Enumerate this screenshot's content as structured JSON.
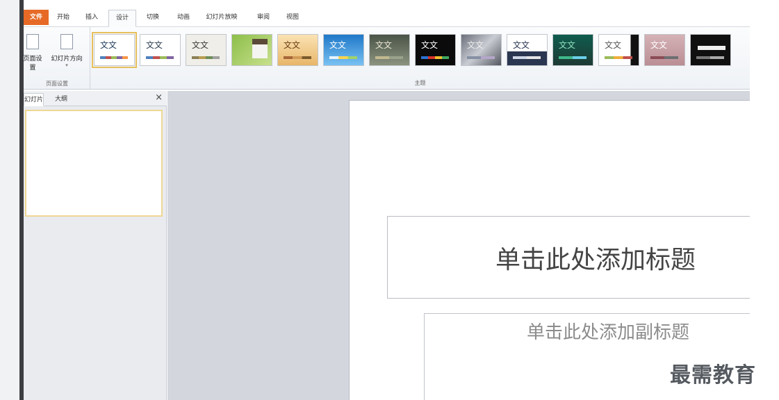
{
  "tabs": {
    "file": "文件",
    "home": "开始",
    "insert": "插入",
    "design": "设计",
    "transitions": "切换",
    "animations": "动画",
    "slideshow": "幻灯片放映",
    "review": "审阅",
    "view": "视图"
  },
  "ribbon": {
    "page_setup_label": "页面设置",
    "slide_orientation_label": "幻灯片方向",
    "page_setup_group": "页面设置",
    "themes_group": "主题",
    "theme_sample_text": "文文"
  },
  "panel": {
    "slides_tab": "幻灯片",
    "outline_tab": "大纲",
    "close_glyph": "×"
  },
  "slide": {
    "title_placeholder": "单击此处添加标题",
    "subtitle_placeholder": "单击此处添加副标题"
  },
  "watermark": "最需教育",
  "colors": {
    "file_tab": "#e66a26",
    "selected_theme_outline": "#e7bf5c",
    "canvas_bg": "#d3d6dc"
  }
}
